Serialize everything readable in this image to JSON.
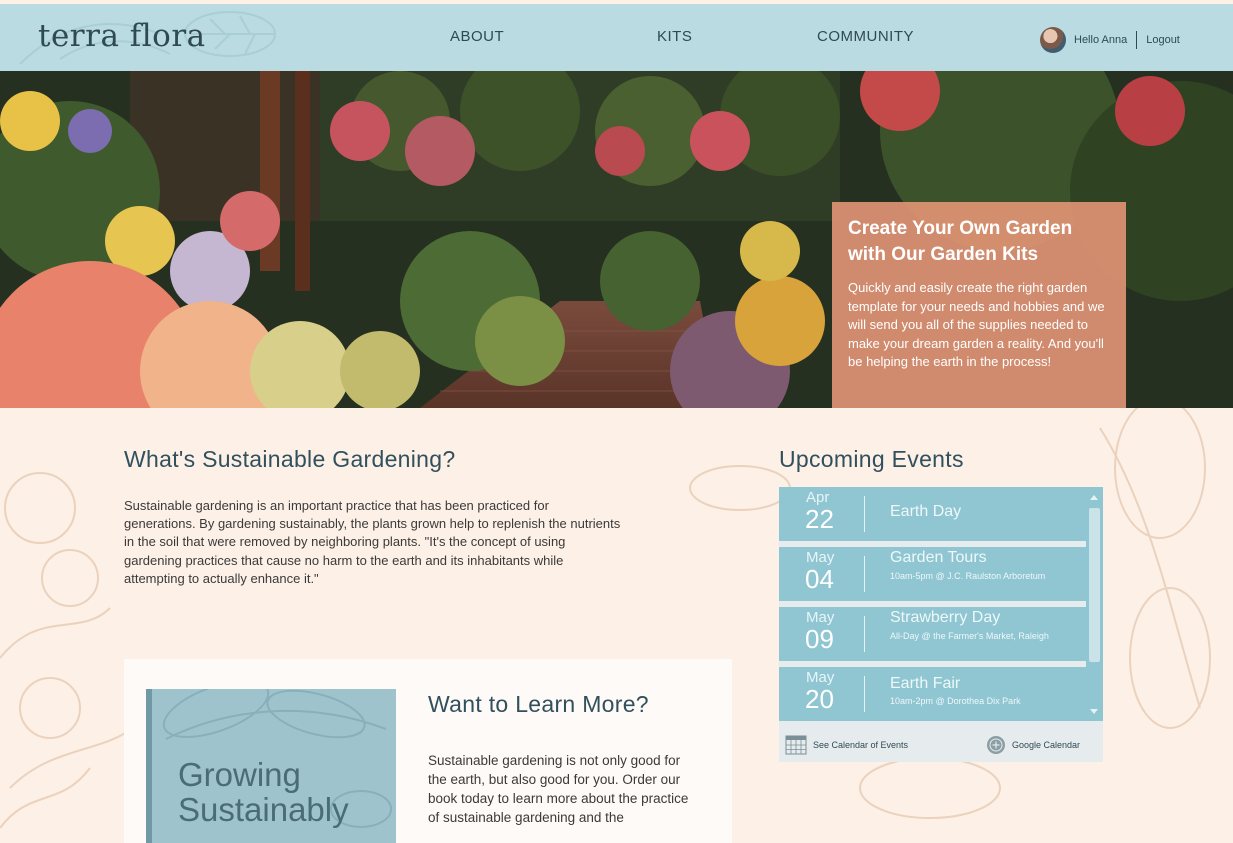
{
  "brand": {
    "logo": "terra flora"
  },
  "nav": {
    "about": "ABOUT",
    "kits": "KITS",
    "community": "COMMUNITY"
  },
  "user": {
    "greeting": "Hello Anna",
    "logout": "Logout"
  },
  "hero": {
    "title": "Create Your Own Garden with Our Garden Kits",
    "body": "Quickly and easily create the right garden template for your needs and hobbies and we will send you all of the supplies needed to make your dream garden a reality. And you'll be helping the earth in the process!",
    "slides": {
      "count": 4,
      "active_index": 2
    }
  },
  "sustainable": {
    "heading": "What's Sustainable Gardening?",
    "body": "Sustainable gardening is an important practice that has been practiced for generations. By gardening sustainably, the plants grown help to replenish the nutrients in the soil that were removed by neighboring plants. \"It's the concept of using gardening practices that cause no harm to the earth and its inhabitants while attempting to actually enhance it.\""
  },
  "events": {
    "heading": "Upcoming Events",
    "items": [
      {
        "month": "Apr",
        "day": "22",
        "title": "Earth Day",
        "detail": ""
      },
      {
        "month": "May",
        "day": "04",
        "title": "Garden Tours",
        "detail": "10am-5pm @ J.C. Raulston Arboretum"
      },
      {
        "month": "May",
        "day": "09",
        "title": "Strawberry Day",
        "detail": "All-Day @ the Farmer's Market, Raleigh"
      },
      {
        "month": "May",
        "day": "20",
        "title": "Earth Fair",
        "detail": "10am-2pm @ Dorothea Dix Park"
      }
    ],
    "calendar_link": "See Calendar of Events",
    "google_link": "Google Calendar"
  },
  "learn": {
    "heading": "Want to Learn More?",
    "body": "Sustainable gardening is not only good for the earth, but also good for you. Order our book today to learn more about the practice of sustainable gardening and the",
    "book_title_line1": "Growing",
    "book_title_line2": "Sustainably"
  },
  "colors": {
    "header_bg": "#b9dbe1",
    "page_bg": "#fdf0e7",
    "accent_coral": "#e89678",
    "event_blue": "#8fc6d2",
    "heading_teal": "#31505d"
  },
  "icons": [
    "calendar-grid-icon",
    "google-plus-circle-icon",
    "user-avatar"
  ]
}
